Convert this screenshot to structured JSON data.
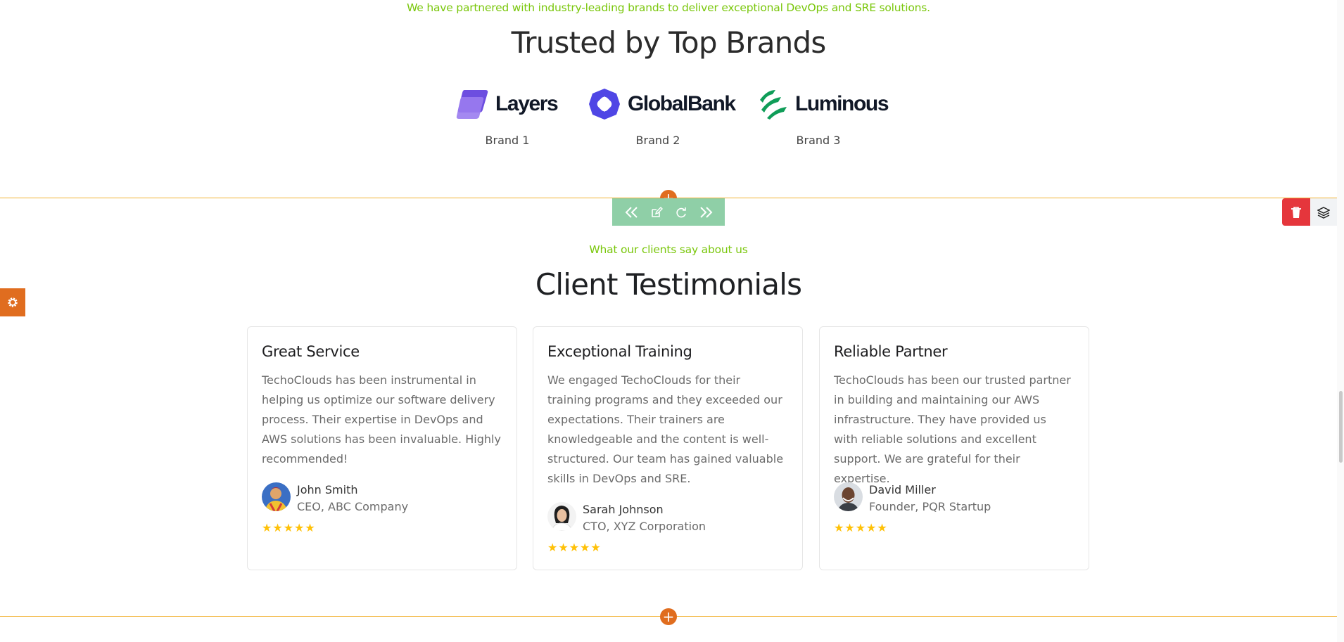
{
  "brands_section": {
    "subtitle": "We have partnered with industry-leading brands to deliver exceptional DevOps and SRE solutions.",
    "title": "Trusted by Top Brands",
    "brands": [
      {
        "logo_text": "Layers",
        "caption": "Brand 1",
        "color": "#7c5ce6"
      },
      {
        "logo_text": "GlobalBank",
        "caption": "Brand 2",
        "color": "#4f46e5"
      },
      {
        "logo_text": "Luminous",
        "caption": "Brand 3",
        "color": "#0f9d58"
      }
    ]
  },
  "editor": {
    "add_section_icon": "plus-icon",
    "toolbar_icons": [
      "double-chevron-left-icon",
      "edit-icon",
      "refresh-icon",
      "double-chevron-right-icon"
    ],
    "delete_icon": "trash-icon",
    "layers_icon": "layers-icon",
    "settings_icon": "gear-icon",
    "accent_color": "#e06d1f",
    "rail_color": "#f2b233",
    "toolbar_color": "#8fcfa7",
    "delete_color": "#e5363c"
  },
  "testimonials_section": {
    "subtitle": "What our clients say about us",
    "title": "Client Testimonials",
    "cards": [
      {
        "title": "Great Service",
        "text": "TechoClouds has been instrumental in helping us optimize our software delivery process. Their expertise in DevOps and AWS solutions has been invaluable. Highly recommended!",
        "author_name": "John Smith",
        "author_role": "CEO, ABC Company",
        "rating": 5,
        "stars": "★★★★★"
      },
      {
        "title": "Exceptional Training",
        "text": "We engaged TechoClouds for their training programs and they exceeded our expectations. Their trainers are knowledgeable and the content is well-structured. Our team has gained valuable skills in DevOps and SRE.",
        "author_name": "Sarah Johnson",
        "author_role": "CTO, XYZ Corporation",
        "rating": 5,
        "stars": "★★★★★"
      },
      {
        "title": "Reliable Partner",
        "text": "TechoClouds has been our trusted partner in building and maintaining our AWS infrastructure. They have provided us with reliable solutions and excellent support. We are grateful for their expertise.",
        "author_name": "David Miller",
        "author_role": "Founder, PQR Startup",
        "rating": 5,
        "stars": "★★★★★"
      }
    ]
  }
}
